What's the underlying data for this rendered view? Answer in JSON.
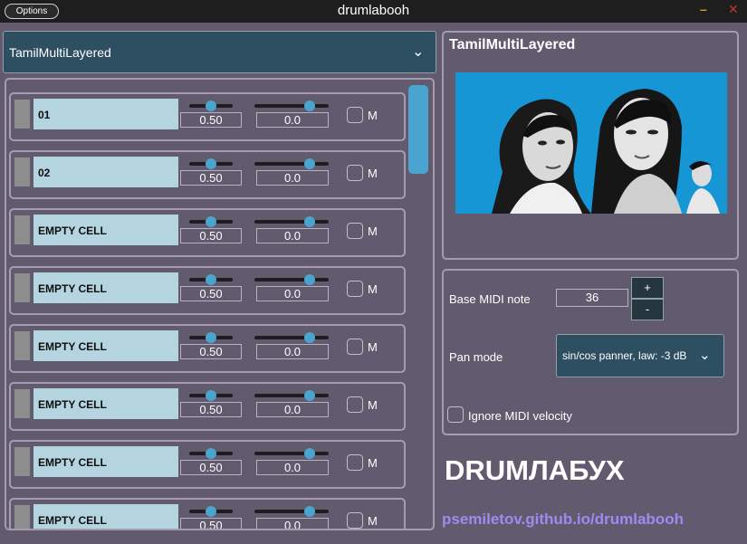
{
  "titlebar": {
    "options_label": "Options",
    "title": "drumlabooh"
  },
  "kit_selector": {
    "value": "TamilMultiLayered"
  },
  "cells": [
    {
      "name": "01",
      "gain": "0.50",
      "pan": "0.0",
      "mute_label": "M"
    },
    {
      "name": "02",
      "gain": "0.50",
      "pan": "0.0",
      "mute_label": "M"
    },
    {
      "name": "EMPTY CELL",
      "gain": "0.50",
      "pan": "0.0",
      "mute_label": "M"
    },
    {
      "name": "EMPTY CELL",
      "gain": "0.50",
      "pan": "0.0",
      "mute_label": "M"
    },
    {
      "name": "EMPTY CELL",
      "gain": "0.50",
      "pan": "0.0",
      "mute_label": "M"
    },
    {
      "name": "EMPTY CELL",
      "gain": "0.50",
      "pan": "0.0",
      "mute_label": "M"
    },
    {
      "name": "EMPTY CELL",
      "gain": "0.50",
      "pan": "0.0",
      "mute_label": "M"
    },
    {
      "name": "EMPTY CELL",
      "gain": "0.50",
      "pan": "0.0",
      "mute_label": "M"
    }
  ],
  "kit_panel": {
    "title": "TamilMultiLayered"
  },
  "settings": {
    "base_midi_label": "Base MIDI note",
    "base_midi_value": "36",
    "plus_label": "+",
    "minus_label": "-",
    "pan_mode_label": "Pan mode",
    "pan_mode_value": "sin/cos panner, law: -3 dB",
    "ignore_velocity_label": "Ignore MIDI velocity"
  },
  "logo_text": "DRUMЛАБУХ",
  "site_link": "psemiletov.github.io/drumlabooh",
  "colors": {
    "accent": "#4aa4cf",
    "panel_bg": "#625a6e",
    "select_bg": "#2e4f61",
    "cell_name_bg": "#b4d4df",
    "link": "#9c8cf0"
  }
}
